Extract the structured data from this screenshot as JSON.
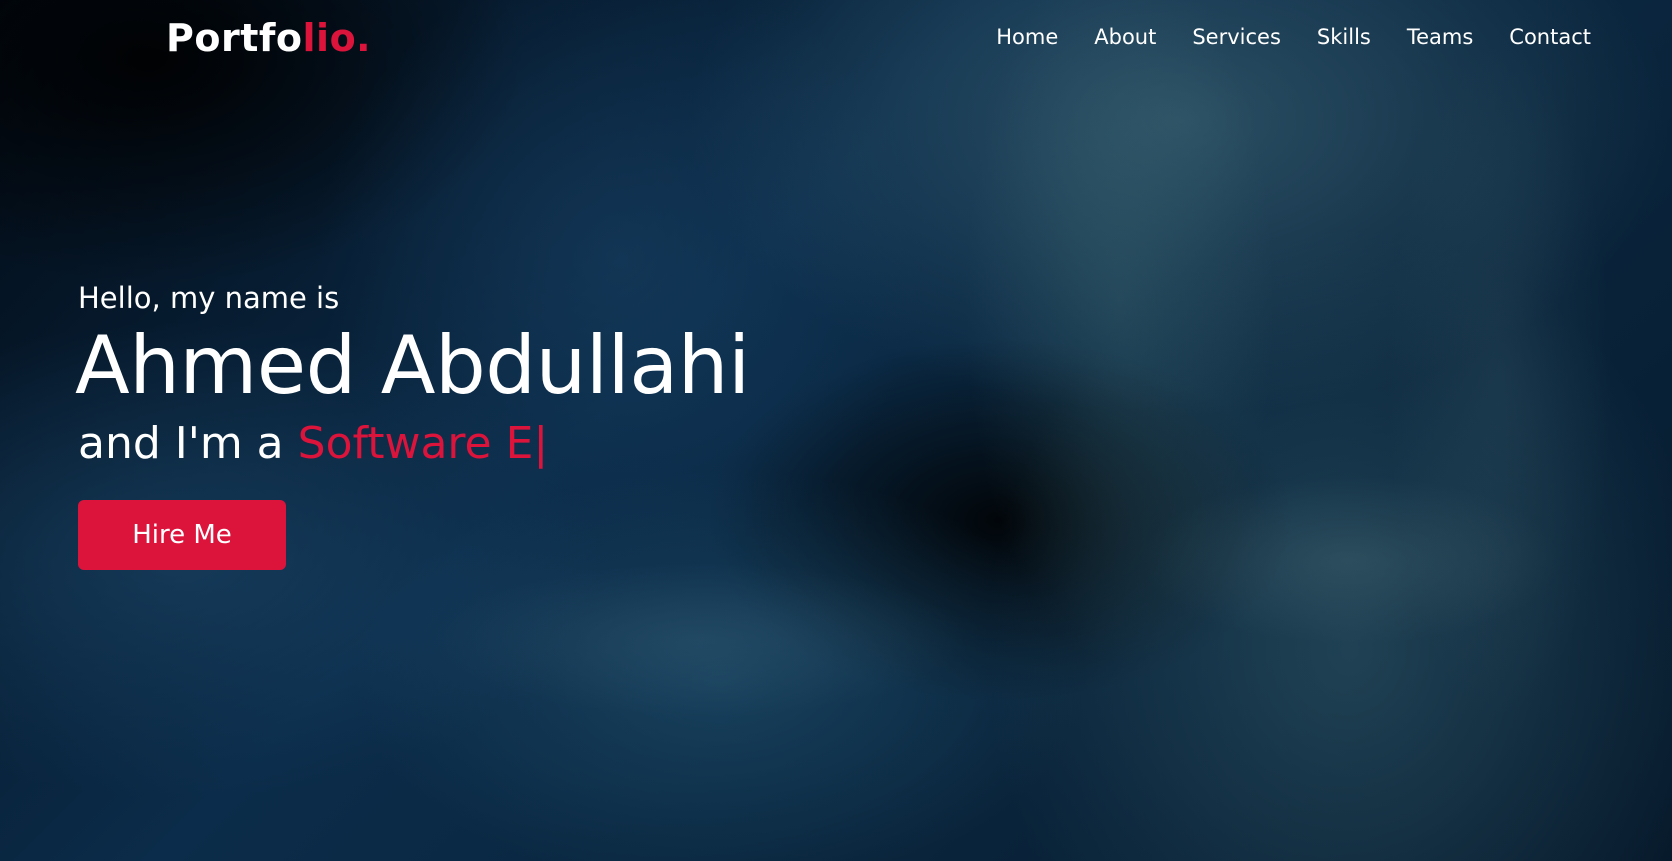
{
  "logo": {
    "main": "Portfo",
    "accent": "lio."
  },
  "nav": {
    "items": [
      {
        "label": "Home"
      },
      {
        "label": "About"
      },
      {
        "label": "Services"
      },
      {
        "label": "Skills"
      },
      {
        "label": "Teams"
      },
      {
        "label": "Contact"
      }
    ]
  },
  "hero": {
    "greeting": "Hello, my name is",
    "name": "Ahmed Abdullahi",
    "role_prefix": "and I'm a ",
    "role_typed": "Software E",
    "cursor": "|",
    "button_label": "Hire Me"
  },
  "colors": {
    "accent": "#dc143c",
    "text": "#ffffff",
    "background": "#0b2c4a"
  }
}
